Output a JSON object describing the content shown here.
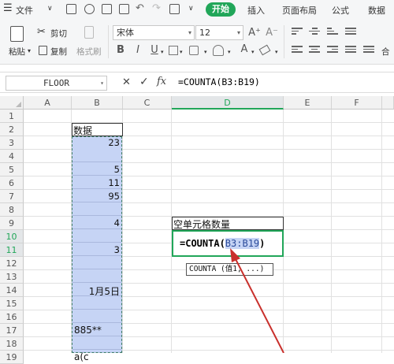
{
  "menu": {
    "file_label": "文件",
    "items": [
      "开始",
      "插入",
      "页面布局",
      "公式",
      "数据"
    ]
  },
  "ribbon": {
    "paste_label": "粘贴",
    "cut_label": "剪切",
    "copy_label": "复制",
    "format_painter_label": "格式刷",
    "font_name": "宋体",
    "font_size": "12",
    "font_grow": "A⁺",
    "font_shrink": "A⁻",
    "bold": "B",
    "italic": "I",
    "underline": "U",
    "font_color": "A",
    "more_label": "合"
  },
  "formula_bar": {
    "name_box": "FLOOR",
    "cancel": "✕",
    "enter": "✓",
    "fx": "fx",
    "formula": "=COUNTA(B3:B19)"
  },
  "columns": [
    "A",
    "B",
    "C",
    "D",
    "E",
    "F"
  ],
  "rows": [
    "1",
    "2",
    "3",
    "4",
    "5",
    "6",
    "7",
    "8",
    "9",
    "10",
    "11",
    "12",
    "13",
    "14",
    "15",
    "16",
    "17",
    "18",
    "19"
  ],
  "cells": {
    "b2": "数据",
    "b3": "23",
    "b5": "5",
    "b6": "11",
    "b7": "95",
    "b9": "4",
    "b11": "3",
    "b14": "1月5日",
    "b17": "885**",
    "b19": "a(c"
  },
  "result_cell": {
    "label": "空单元格数量",
    "formula_prefix": "=COUNTA(",
    "formula_ref": "B3:B19",
    "formula_suffix": ")"
  },
  "tooltip": {
    "text": "COUNTA (值1, ...)"
  },
  "colors": {
    "accent": "#21a659",
    "selection_fill": "#c6d4f5",
    "arrow": "#c9302c"
  }
}
